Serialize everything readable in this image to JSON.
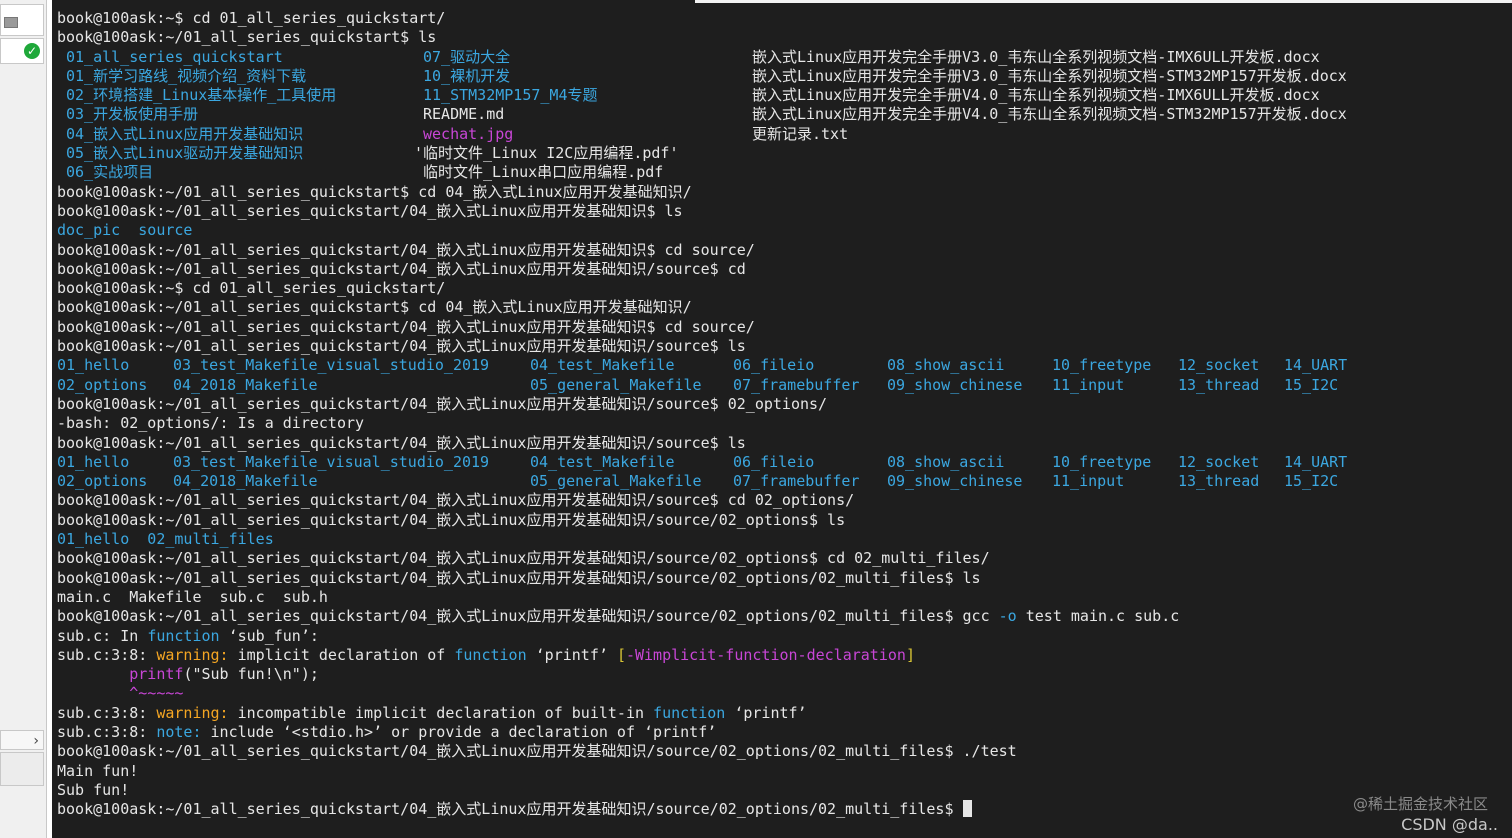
{
  "colors": {
    "background": "#1e1e1e",
    "text": "#e6e6e6",
    "dir": "#3ba7e0",
    "image": "#c846d6",
    "warning": "#f5a623",
    "flag": "#d6c335"
  },
  "terminal": {
    "l0": "book@100ask:~$ cd 01_all_series_quickstart/",
    "l1": "book@100ask:~/01_all_series_quickstart$ ls",
    "ls1": {
      "c1": [
        "01_all_series_quickstart",
        "01_新学习路线_视频介绍_资料下载",
        "02_环境搭建_Linux基本操作_工具使用",
        "03_开发板使用手册",
        "04_嵌入式Linux应用开发基础知识",
        "05_嵌入式Linux驱动开发基础知识",
        "06_实战项目"
      ],
      "c2": [
        "07_驱动大全",
        "10_裸机开发",
        "11_STM32MP157_M4专题",
        "README.md",
        "wechat.jpg",
        "'临时文件_Linux I2C应用编程.pdf'",
        "临时文件_Linux串口应用编程.pdf"
      ],
      "c3": [
        "嵌入式Linux应用开发完全手册V3.0_韦东山全系列视频文档-IMX6ULL开发板.docx",
        "嵌入式Linux应用开发完全手册V3.0_韦东山全系列视频文档-STM32MP157开发板.docx",
        "嵌入式Linux应用开发完全手册V4.0_韦东山全系列视频文档-IMX6ULL开发板.docx",
        "嵌入式Linux应用开发完全手册V4.0_韦东山全系列视频文档-STM32MP157开发板.docx",
        "更新记录.txt"
      ]
    },
    "l9": "book@100ask:~/01_all_series_quickstart$ cd 04_嵌入式Linux应用开发基础知识/",
    "l10": "book@100ask:~/01_all_series_quickstart/04_嵌入式Linux应用开发基础知识$ ls",
    "l11": "doc_pic  source",
    "l12": "book@100ask:~/01_all_series_quickstart/04_嵌入式Linux应用开发基础知识$ cd source/",
    "l13": "book@100ask:~/01_all_series_quickstart/04_嵌入式Linux应用开发基础知识/source$ cd",
    "l14": "book@100ask:~$ cd 01_all_series_quickstart/",
    "l15": "book@100ask:~/01_all_series_quickstart$ cd 04_嵌入式Linux应用开发基础知识/",
    "l16": "book@100ask:~/01_all_series_quickstart/04_嵌入式Linux应用开发基础知识$ cd source/",
    "l17": "book@100ask:~/01_all_series_quickstart/04_嵌入式Linux应用开发基础知识/source$ ls",
    "src_row1": [
      "01_hello",
      "03_test_Makefile_visual_studio_2019",
      "04_test_Makefile",
      "06_fileio",
      "08_show_ascii",
      "10_freetype",
      "12_socket",
      "14_UART"
    ],
    "src_row2": [
      "02_options",
      "04_2018_Makefile",
      "05_general_Makefile",
      "07_framebuffer",
      "09_show_chinese",
      "11_input",
      "13_thread",
      "15_I2C"
    ],
    "l20": "book@100ask:~/01_all_series_quickstart/04_嵌入式Linux应用开发基础知识/source$ 02_options/",
    "l21": "-bash: 02_options/: Is a directory",
    "l22": "book@100ask:~/01_all_series_quickstart/04_嵌入式Linux应用开发基础知识/source$ ls",
    "l25": "book@100ask:~/01_all_series_quickstart/04_嵌入式Linux应用开发基础知识/source$ cd 02_options/",
    "l26": "book@100ask:~/01_all_series_quickstart/04_嵌入式Linux应用开发基础知识/source/02_options$ ls",
    "l27": "01_hello  02_multi_files",
    "l28": "book@100ask:~/01_all_series_quickstart/04_嵌入式Linux应用开发基础知识/source/02_options$ cd 02_multi_files/",
    "l29": "book@100ask:~/01_all_series_quickstart/04_嵌入式Linux应用开发基础知识/source/02_options/02_multi_files$ ls",
    "l30": "main.c  Makefile  sub.c  sub.h",
    "l31_a": "book@100ask:~/01_all_series_quickstart/04_嵌入式Linux应用开发基础知识/source/02_options/02_multi_files$ gcc ",
    "l31_b": "-o",
    "l31_c": " test main.c sub.c",
    "l32_a": "sub.c: In ",
    "l32_b": "function",
    "l32_c": " ‘sub_fun’:",
    "l33_a": "sub.c:3:8: ",
    "l33_b": "warning:",
    "l33_c": " implicit declaration of ",
    "l33_d": "function",
    "l33_e": " ‘printf’ ",
    "l33_f": "[",
    "l33_g": "-Wimplicit-function-declaration",
    "l33_h": "]",
    "l34_a": "        ",
    "l34_b": "printf",
    "l34_c": "(\"Sub fun!\\n\");",
    "l35_a": "        ",
    "l35_b": "^~~~~~",
    "l36_a": "sub.c:3:8: ",
    "l36_b": "warning:",
    "l36_c": " incompatible implicit declaration of built-in ",
    "l36_d": "function",
    "l36_e": " ‘printf’",
    "l37_a": "sub.c:3:8: ",
    "l37_b": "note:",
    "l37_c": " include ‘<stdio.h>’ or provide a declaration of ‘printf’",
    "l38": "book@100ask:~/01_all_series_quickstart/04_嵌入式Linux应用开发基础知识/source/02_options/02_multi_files$ ./test",
    "l39": "Main fun!",
    "l40": "Sub fun!",
    "l41": "book@100ask:~/01_all_series_quickstart/04_嵌入式Linux应用开发基础知识/source/02_options/02_multi_files$ "
  },
  "watermark": "@稀土掘金技术社区",
  "csdn": "CSDN @da.."
}
